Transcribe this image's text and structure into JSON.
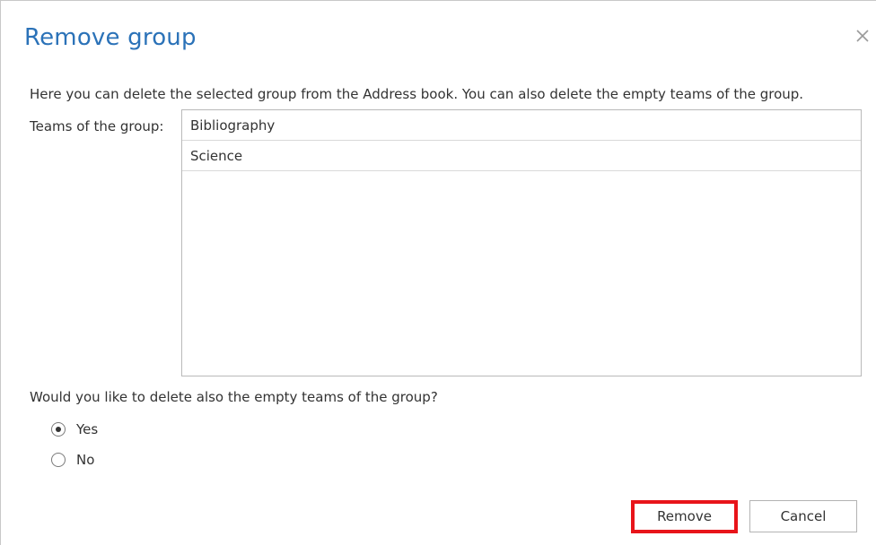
{
  "dialog": {
    "title": "Remove group",
    "close_icon": "close-icon",
    "description": "Here you can delete the selected group from the Address book. You can also delete the empty teams of the group.",
    "teams_label": "Teams of the group:",
    "teams": [
      {
        "label": "Bibliography"
      },
      {
        "label": "Science"
      }
    ],
    "question": "Would you like to delete also the empty teams of the group?",
    "options": [
      {
        "label": "Yes",
        "selected": true
      },
      {
        "label": "No",
        "selected": false
      }
    ],
    "buttons": {
      "remove_label": "Remove",
      "cancel_label": "Cancel"
    },
    "colors": {
      "title": "#2b72b8",
      "highlight": "#e8141a"
    }
  }
}
